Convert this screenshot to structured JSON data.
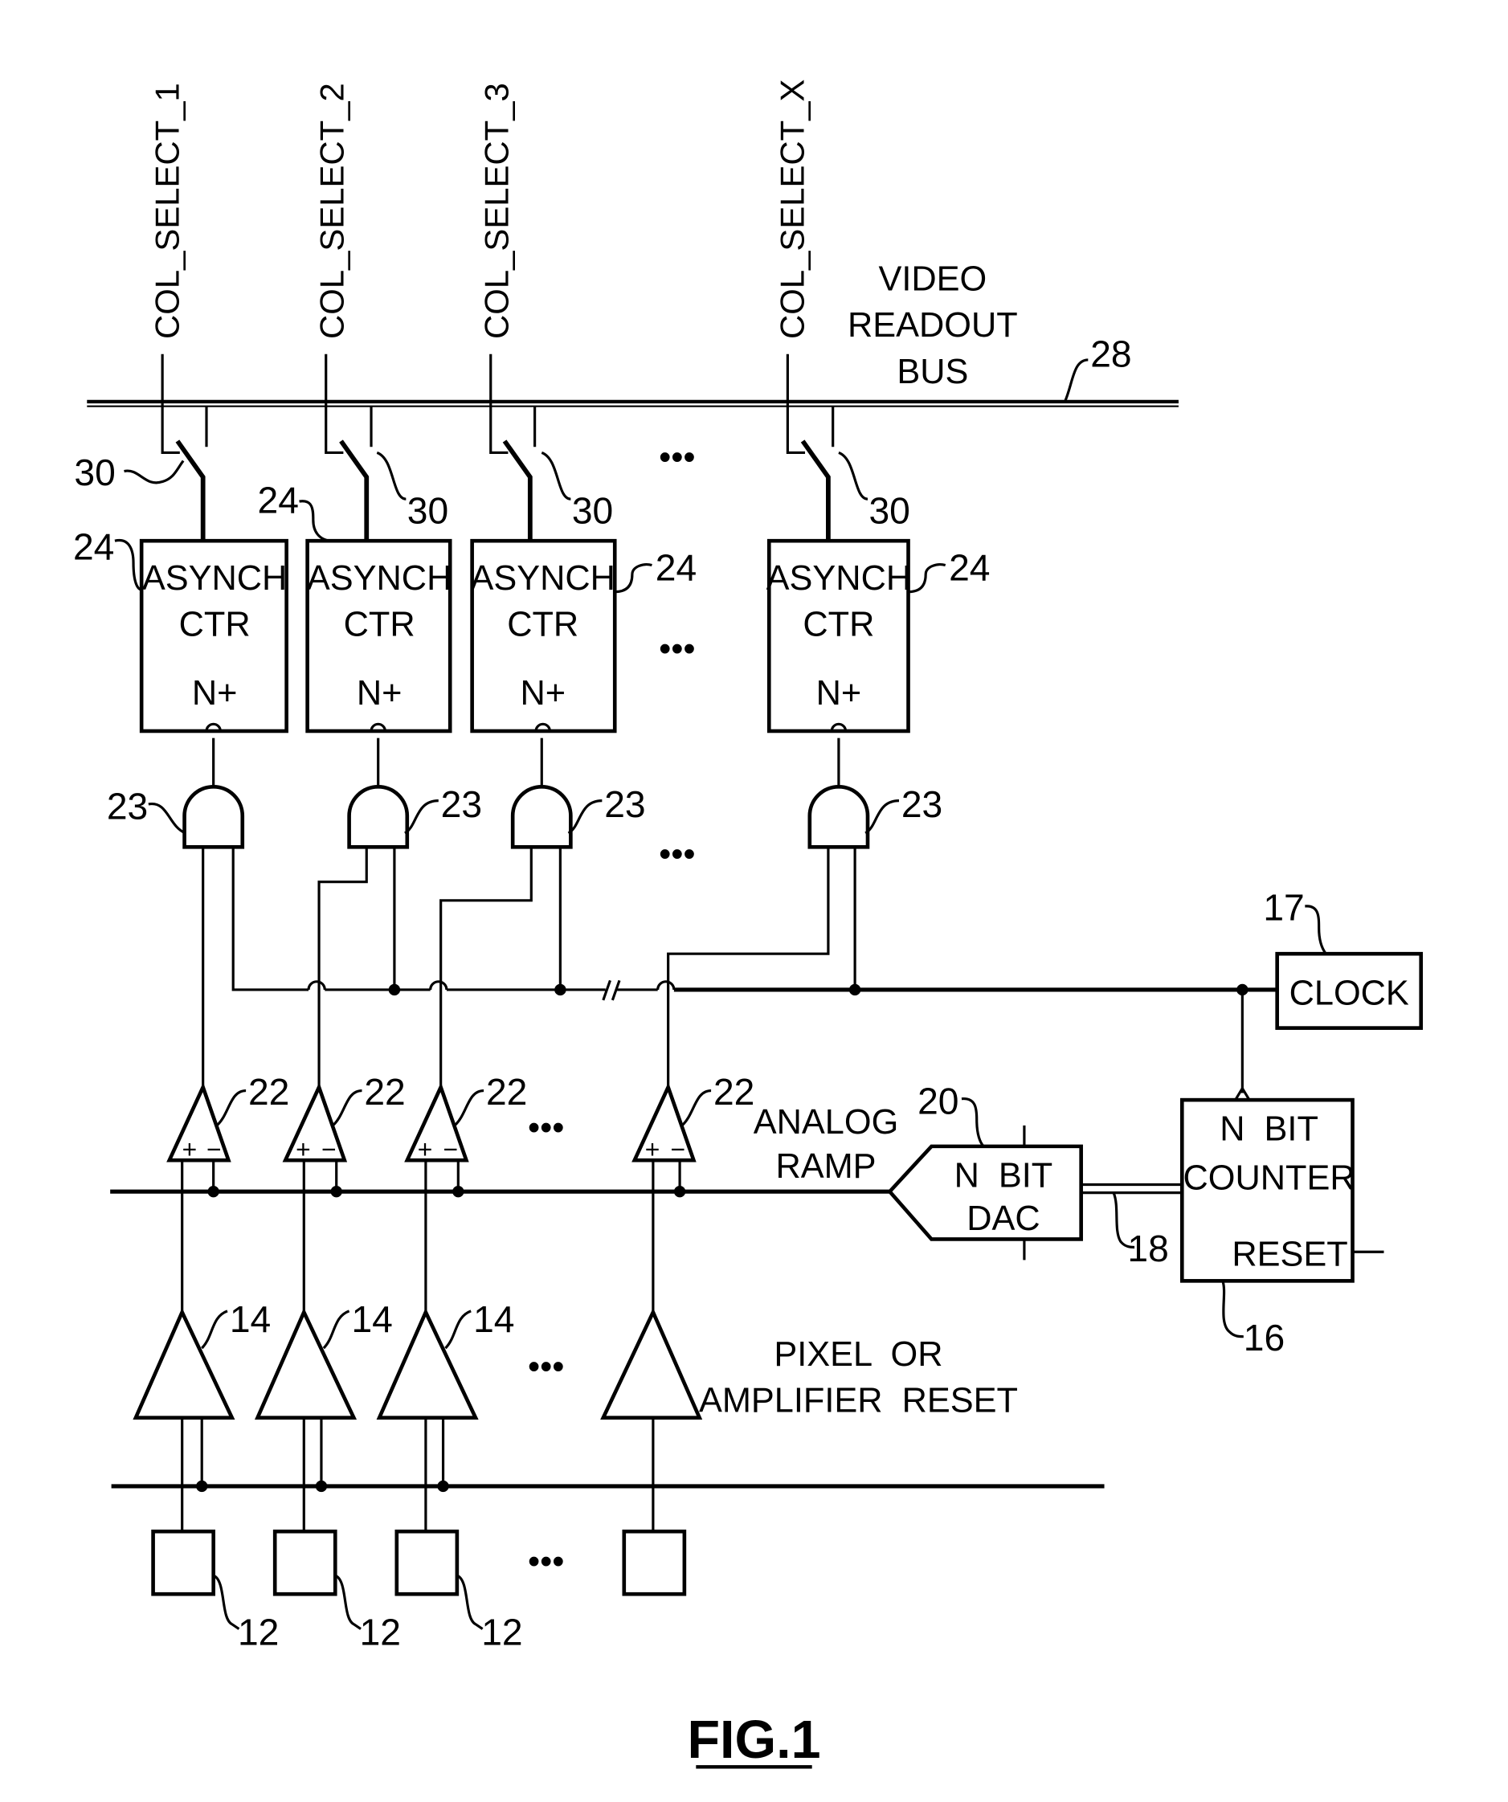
{
  "figure": {
    "title": "FIG.1"
  },
  "column_select_signals": [
    "COL_SELECT_1",
    "COL_SELECT_2",
    "COL_SELECT_3",
    "COL_SELECT_X"
  ],
  "bus": {
    "label_line1": "VIDEO",
    "label_line2": "READOUT",
    "label_line3": "BUS",
    "ref": "28"
  },
  "switches": {
    "ref": "30"
  },
  "counters": {
    "label_line1": "ASYNCH",
    "label_line2": "CTR",
    "label_line3": "N+",
    "ref": "24"
  },
  "and_gates": {
    "ref": "23"
  },
  "clock": {
    "label": "CLOCK",
    "ref": "17"
  },
  "comparators": {
    "ref": "22",
    "plus": "+",
    "minus": "−"
  },
  "analog_ramp": {
    "label_line1": "ANALOG",
    "label_line2": "RAMP"
  },
  "dac": {
    "label_line1": "N  BIT",
    "label_line2": "DAC",
    "ref": "20"
  },
  "bus_link": {
    "ref": "18"
  },
  "counter": {
    "label_line1": "N  BIT",
    "label_line2": "COUNTER",
    "label_line3": "RESET",
    "ref": "16"
  },
  "amplifiers": {
    "ref": "14"
  },
  "reset_line": {
    "label_line1": "PIXEL  OR",
    "label_line2": "AMPLIFIER  RESET"
  },
  "pixels": {
    "ref": "12"
  },
  "ellipsis": "•••"
}
